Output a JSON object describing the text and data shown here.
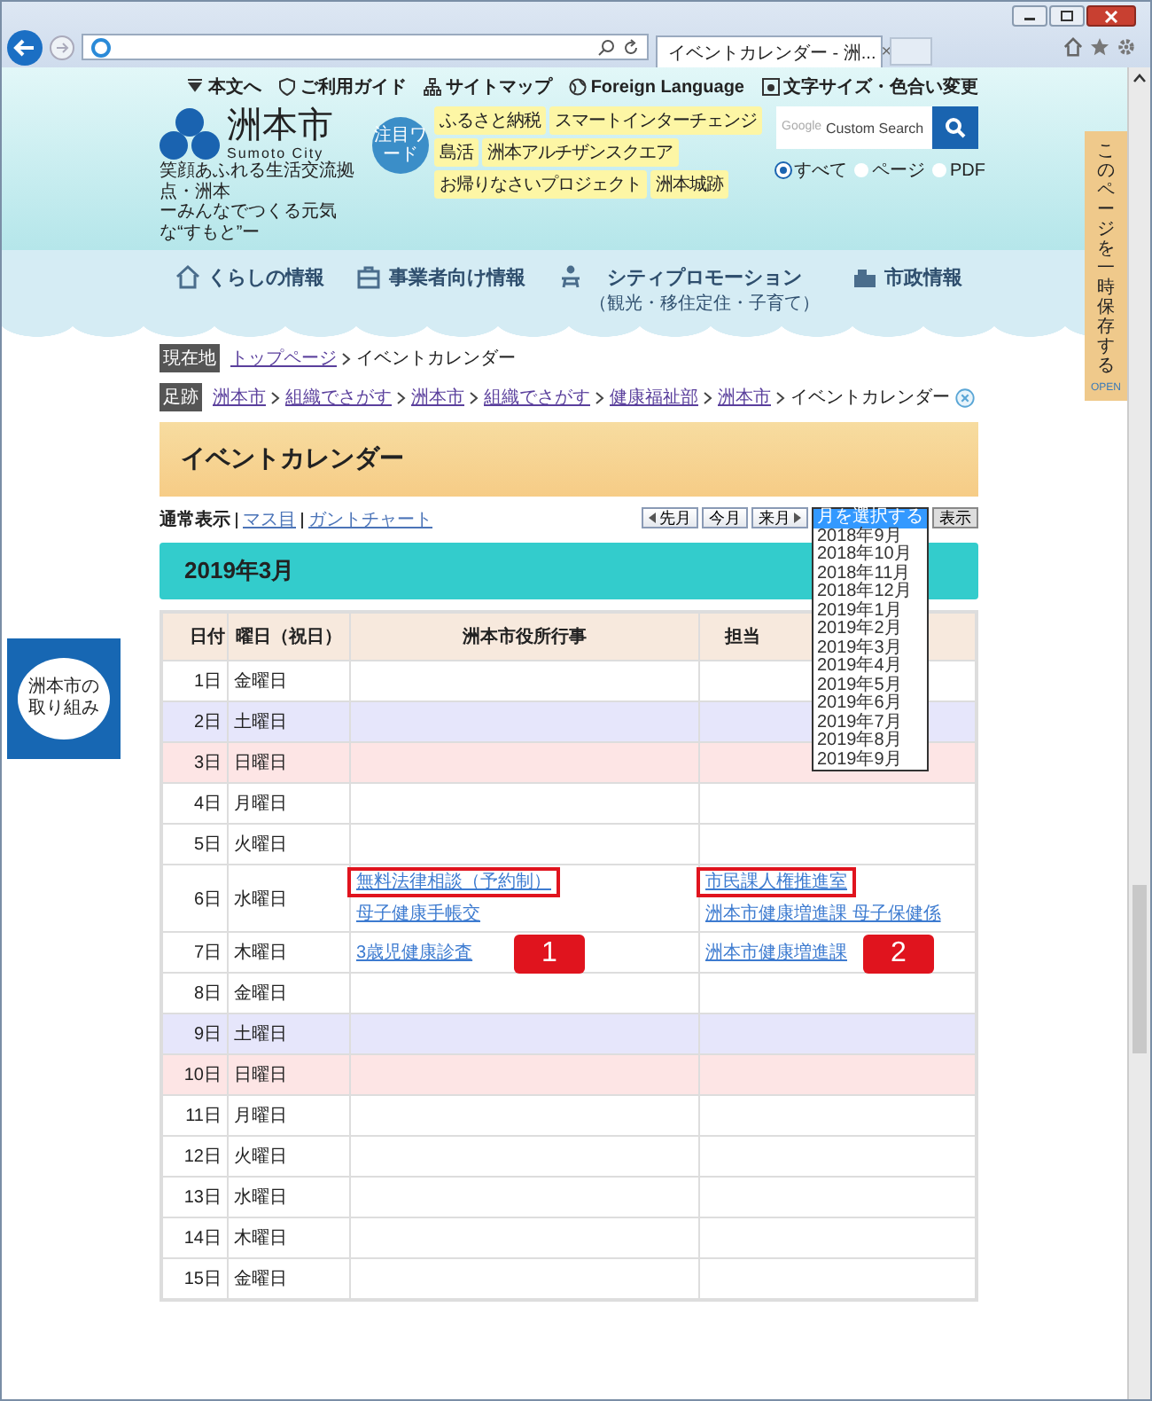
{
  "browser": {
    "tab_title": "イベントカレンダー - 洲...",
    "tab_close": "×"
  },
  "site": {
    "name": "洲本市",
    "sub": "Sumoto City",
    "tagline": [
      "笑顔あふれる生活交流拠点・洲本",
      "ーみんなでつくる元気な“すもと”ー"
    ]
  },
  "top_links": [
    {
      "label": "本文へ"
    },
    {
      "label": "ご利用ガイド"
    },
    {
      "label": "サイトマップ"
    },
    {
      "label": "Foreign Language"
    },
    {
      "label": "文字サイズ・色合い変更"
    }
  ],
  "attention": {
    "label": "注目ワード",
    "tags": [
      "ふるさと納税",
      "スマートインターチェンジ",
      "島活",
      "洲本アルチザンスクエア",
      "お帰りなさいプロジェクト",
      "洲本城跡"
    ]
  },
  "search": {
    "brand": "Google",
    "placeholder": "Custom Search",
    "scopes": [
      {
        "label": "すべて",
        "selected": true
      },
      {
        "label": "ページ",
        "selected": false
      },
      {
        "label": "PDF",
        "selected": false
      }
    ]
  },
  "nav": [
    {
      "label": "くらしの情報"
    },
    {
      "label": "事業者向け情報"
    },
    {
      "label": "シティプロモーション",
      "sub": "（観光・移住定住・子育て）"
    },
    {
      "label": "市政情報"
    }
  ],
  "breadcrumb": {
    "tag": "現在地",
    "links": [
      "トップページ"
    ],
    "current": "イベントカレンダー"
  },
  "footprints": {
    "tag": "足跡",
    "links": [
      "洲本市",
      "組織でさがす",
      "洲本市",
      "組織でさがす",
      "健康福祉部",
      "洲本市"
    ],
    "current": "イベントカレンダー"
  },
  "page_title": "イベントカレンダー",
  "views": [
    {
      "label": "通常表示",
      "selected": true
    },
    {
      "label": "マス目",
      "selected": false
    },
    {
      "label": "ガントチャート",
      "selected": false
    }
  ],
  "month_buttons": [
    "先月",
    "今月",
    "来月"
  ],
  "month_select": [
    {
      "label": "月を選択する",
      "selected": true
    },
    {
      "label": "2018年9月",
      "selected": false
    },
    {
      "label": "2018年10月",
      "selected": false
    },
    {
      "label": "2018年11月",
      "selected": false
    },
    {
      "label": "2018年12月",
      "selected": false
    },
    {
      "label": "2019年1月",
      "selected": false
    },
    {
      "label": "2019年2月",
      "selected": false
    },
    {
      "label": "2019年3月",
      "selected": false
    },
    {
      "label": "2019年4月",
      "selected": false
    },
    {
      "label": "2019年5月",
      "selected": false
    },
    {
      "label": "2019年6月",
      "selected": false
    },
    {
      "label": "2019年7月",
      "selected": false
    },
    {
      "label": "2019年8月",
      "selected": false
    },
    {
      "label": "2019年9月",
      "selected": false
    }
  ],
  "show_button": "表示",
  "month_heading": "2019年3月",
  "table": {
    "columns": [
      "日付",
      "曜日（祝日）",
      "洲本市役所行事",
      "担当"
    ],
    "rows": [
      {
        "date": "1日",
        "weekday": "金曜日",
        "kind": "weekday"
      },
      {
        "date": "2日",
        "weekday": "土曜日",
        "kind": "saturday"
      },
      {
        "date": "3日",
        "weekday": "日曜日",
        "kind": "sunday"
      },
      {
        "date": "4日",
        "weekday": "月曜日",
        "kind": "weekday"
      },
      {
        "date": "5日",
        "weekday": "火曜日",
        "kind": "weekday"
      },
      {
        "date": "6日",
        "weekday": "水曜日",
        "kind": "weekday",
        "events": [
          {
            "label": "無料法律相談（予約制）",
            "highlighted": true
          },
          {
            "label": "母子健康手帳交",
            "highlighted": false
          }
        ],
        "depts": [
          {
            "label": "市民課人権推進室",
            "highlighted": true
          },
          {
            "label": "洲本市健康増進課 母子保健係",
            "highlighted": false
          }
        ]
      },
      {
        "date": "7日",
        "weekday": "木曜日",
        "kind": "weekday",
        "events": [
          {
            "label": "3歳児健康診査",
            "highlighted": false
          }
        ],
        "depts": [
          {
            "label": "洲本市健康増進課",
            "highlighted": false
          }
        ],
        "event_badge": "1",
        "dept_badge": "2"
      },
      {
        "date": "8日",
        "weekday": "金曜日",
        "kind": "weekday"
      },
      {
        "date": "9日",
        "weekday": "土曜日",
        "kind": "saturday"
      },
      {
        "date": "10日",
        "weekday": "日曜日",
        "kind": "sunday"
      },
      {
        "date": "11日",
        "weekday": "月曜日",
        "kind": "weekday"
      },
      {
        "date": "12日",
        "weekday": "火曜日",
        "kind": "weekday"
      },
      {
        "date": "13日",
        "weekday": "水曜日",
        "kind": "weekday"
      },
      {
        "date": "14日",
        "weekday": "木曜日",
        "kind": "weekday"
      },
      {
        "date": "15日",
        "weekday": "金曜日",
        "kind": "weekday"
      }
    ]
  },
  "side_badge": "洲本市の取り組み",
  "save_tab": {
    "label": "このページを一時保存する",
    "open": "OPEN"
  }
}
